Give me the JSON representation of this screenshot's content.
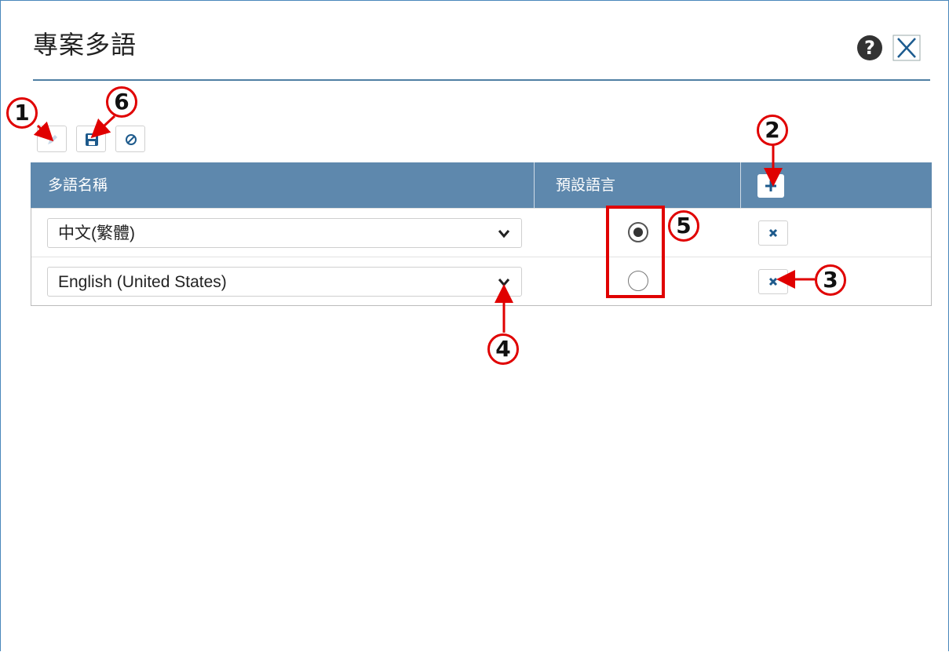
{
  "dialog": {
    "title": "專案多語",
    "help_icon": "question-circle-icon",
    "help_glyph": "?",
    "close_icon": "close-icon"
  },
  "toolbar": {
    "buttons": [
      {
        "name": "edit-button",
        "icon": "pencil-icon",
        "enabled": false
      },
      {
        "name": "save-button",
        "icon": "floppy-disk-icon",
        "enabled": true
      },
      {
        "name": "cancel-button",
        "icon": "ban-icon",
        "enabled": true
      }
    ]
  },
  "table": {
    "headers": {
      "language_name": "多語名稱",
      "default_language": "預設語言",
      "add_icon": "plus-icon"
    },
    "rows": [
      {
        "language": "中文(繁體)",
        "is_default": true
      },
      {
        "language": "English (United States)",
        "is_default": false
      }
    ]
  },
  "annotations": [
    "1",
    "2",
    "3",
    "4",
    "5",
    "6"
  ],
  "colors": {
    "header_bg": "#5e88ad",
    "annotation_red": "#e00000",
    "border_blue": "#4a87bb"
  }
}
